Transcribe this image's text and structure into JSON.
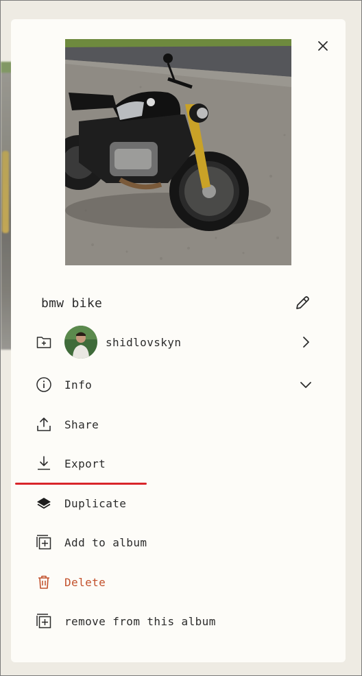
{
  "window": {
    "close_icon": "close-icon"
  },
  "photo": {
    "alt": "bmw bike"
  },
  "title": {
    "text": "bmw bike",
    "edit_icon": "pencil-icon"
  },
  "owner": {
    "name": "shidlovskyn",
    "icon": "folder-plus-icon"
  },
  "menu": {
    "info": {
      "label": "Info",
      "icon": "info-icon"
    },
    "share": {
      "label": "Share",
      "icon": "share-icon"
    },
    "export": {
      "label": "Export",
      "icon": "download-icon"
    },
    "duplicate": {
      "label": "Duplicate",
      "icon": "layers-icon"
    },
    "add_to_album": {
      "label": "Add to album",
      "icon": "add-to-album-icon"
    },
    "delete": {
      "label": "Delete",
      "icon": "trash-icon"
    },
    "remove_from_album": {
      "label": "remove from this album",
      "icon": "remove-from-album-icon"
    }
  },
  "colors": {
    "panel_bg": "#fdfcf8",
    "page_bg": "#eeebe3",
    "text": "#2b2b2b",
    "danger": "#c2502b",
    "highlight_underline": "#d9252a"
  }
}
